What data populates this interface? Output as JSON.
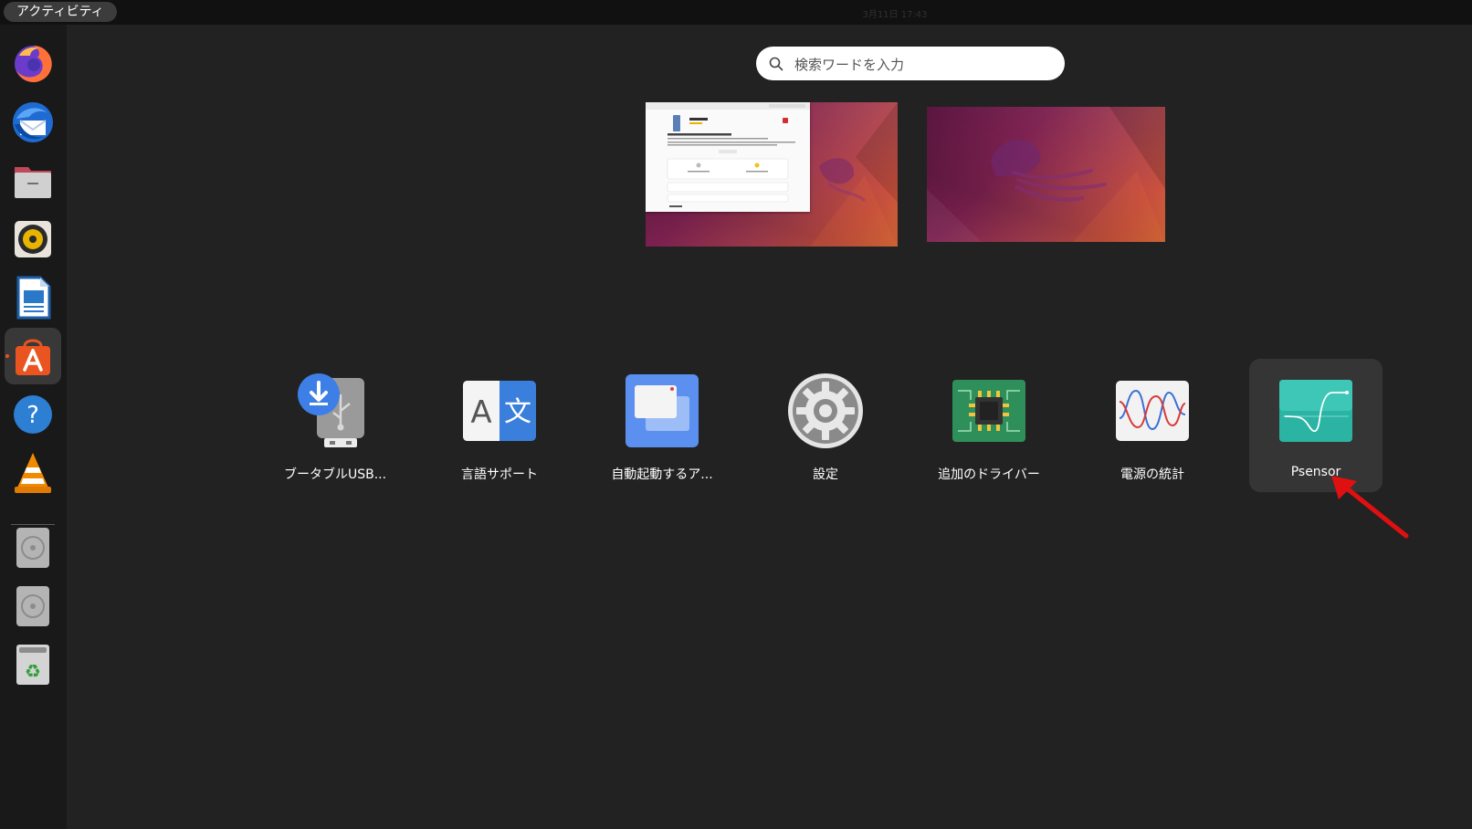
{
  "topbar": {
    "activities_label": "アクティビティ",
    "clock_text": "3月11日 17:43"
  },
  "dock": {
    "items": [
      {
        "name": "Firefox",
        "icon": "firefox-icon"
      },
      {
        "name": "Thunderbird",
        "icon": "thunderbird-icon"
      },
      {
        "name": "Files",
        "icon": "files-icon"
      },
      {
        "name": "Rhythmbox",
        "icon": "rhythmbox-icon"
      },
      {
        "name": "LibreOffice Writer",
        "icon": "writer-icon"
      },
      {
        "name": "Ubuntu Software",
        "icon": "ubuntu-software-icon",
        "active": true
      },
      {
        "name": "Help",
        "icon": "help-icon"
      },
      {
        "name": "VLC",
        "icon": "vlc-icon"
      },
      {
        "name": "Drive",
        "icon": "drive-icon"
      },
      {
        "name": "Drive",
        "icon": "drive-icon"
      },
      {
        "name": "Trash",
        "icon": "trash-icon"
      }
    ]
  },
  "search": {
    "placeholder": "検索ワードを入力",
    "value": ""
  },
  "workspaces": [
    {
      "index": 1,
      "has_window": true
    },
    {
      "index": 2,
      "has_window": false
    }
  ],
  "apps": [
    {
      "label": "ブータブルUSB...",
      "icon": "usb-creator-icon"
    },
    {
      "label": "言語サポート",
      "icon": "language-support-icon"
    },
    {
      "label": "自動起動するア...",
      "icon": "startup-apps-icon"
    },
    {
      "label": "設定",
      "icon": "settings-icon"
    },
    {
      "label": "追加のドライバー",
      "icon": "additional-drivers-icon"
    },
    {
      "label": "電源の統計",
      "icon": "power-statistics-icon"
    },
    {
      "label": "Psensor",
      "icon": "psensor-icon",
      "selected": true
    }
  ],
  "colors": {
    "background": "#222222",
    "topbar": "#111111",
    "dock": "#191919",
    "accent": "#e95420",
    "selection": "#353535",
    "annotation_arrow": "#e01010"
  }
}
